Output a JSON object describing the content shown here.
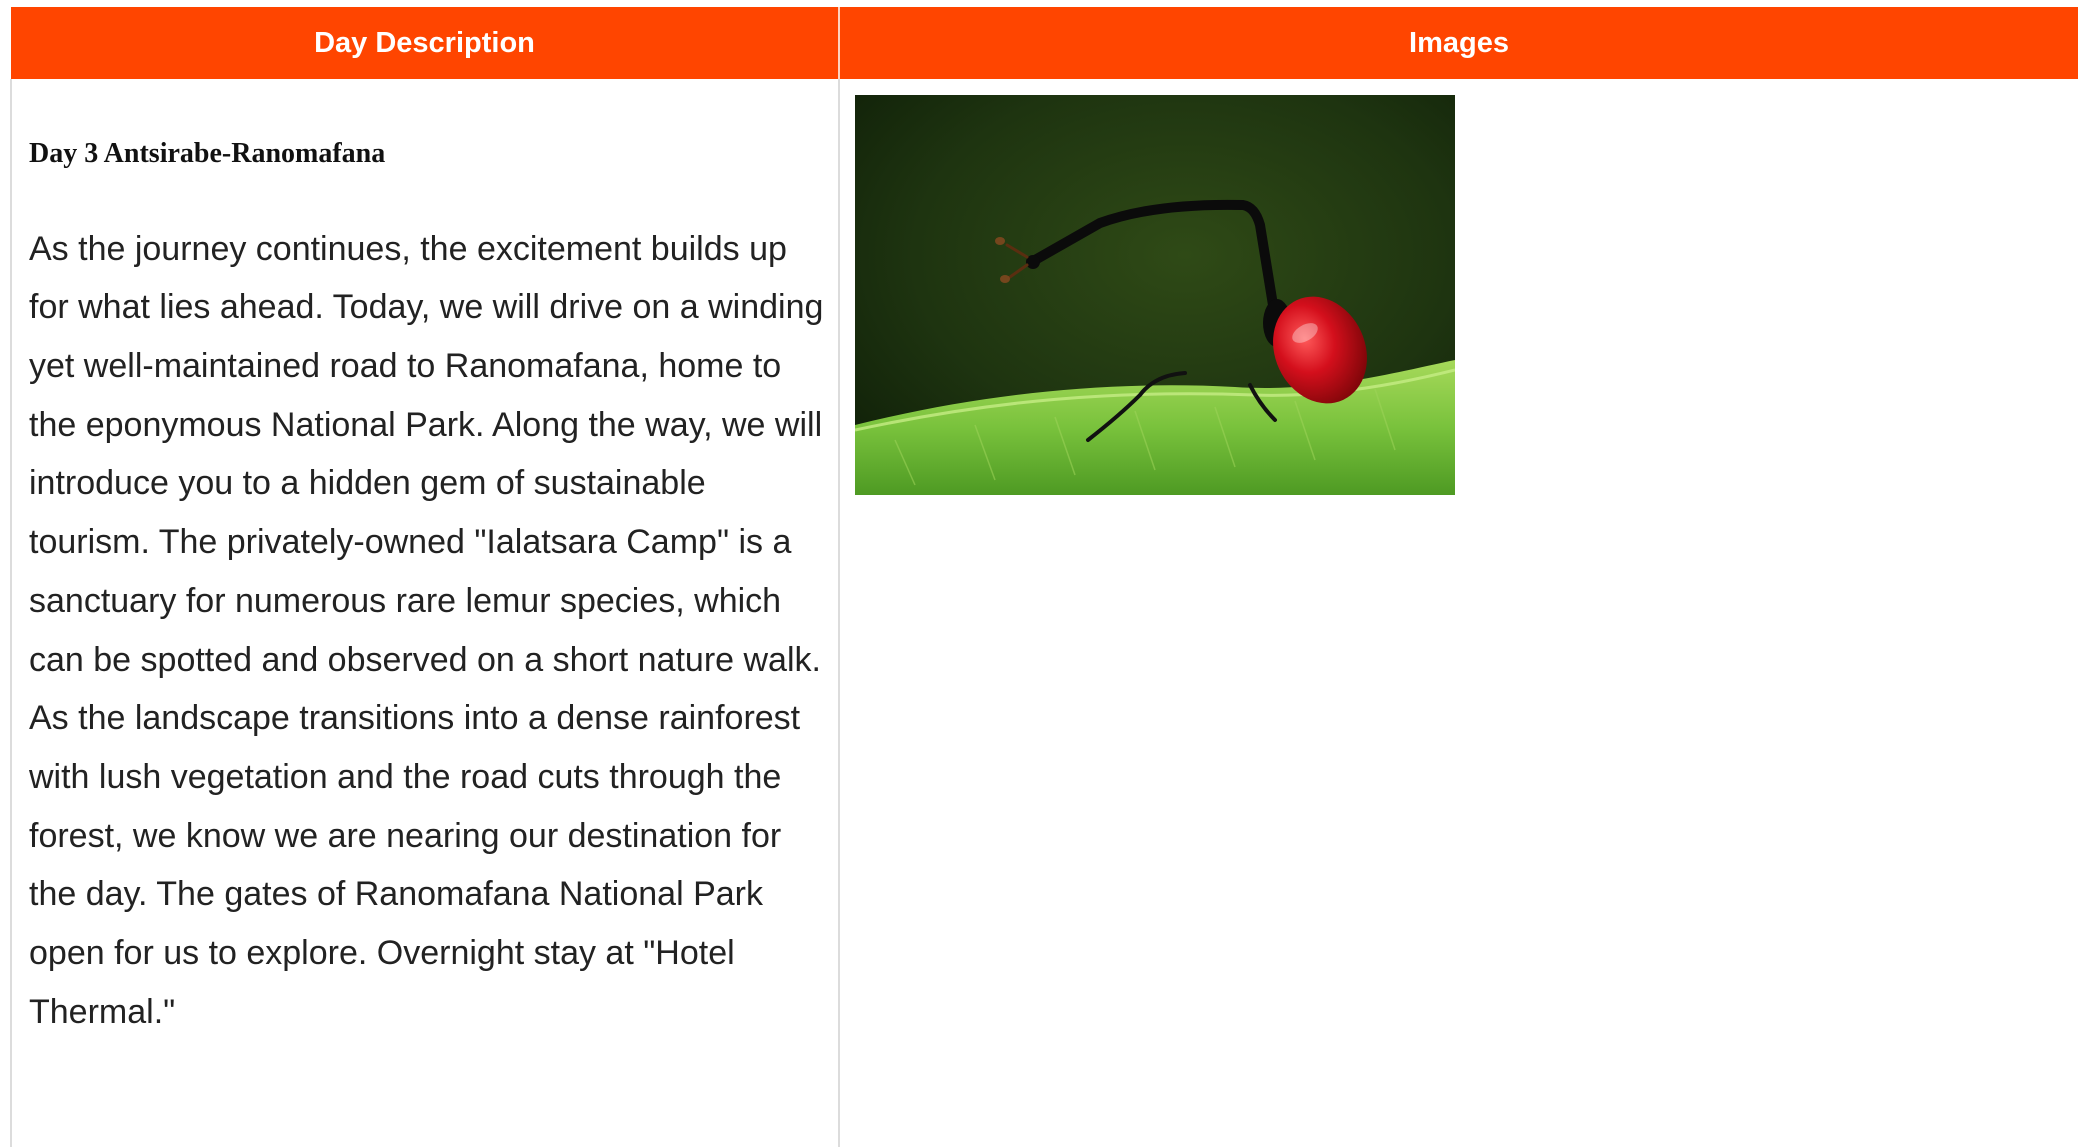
{
  "table": {
    "headers": {
      "description": "Day Description",
      "images": "Images"
    },
    "colors": {
      "header_bg": "#ff4500",
      "header_text": "#ffffff"
    }
  },
  "day": {
    "title": "Day 3 Antsirabe-Ranomafana",
    "body": "As the journey continues, the excitement builds up for what lies ahead. Today, we will drive on a winding yet well-maintained road to Ranomafana, home to the eponymous National Park. Along the way, we will introduce you to a hidden gem of sustainable tourism. The privately-owned \"Ialatsara Camp\" is a sanctuary for numerous rare lemur species, which can be spotted and observed on a short nature walk. As the landscape transitions into a dense rainforest with lush vegetation and the road cuts through the forest, we know we are nearing our destination for the day. The gates of Ranomafana National Park open for us to explore. Overnight stay at \"Hotel Thermal.\""
  },
  "image": {
    "subject": "giraffe-weevil-photo"
  }
}
